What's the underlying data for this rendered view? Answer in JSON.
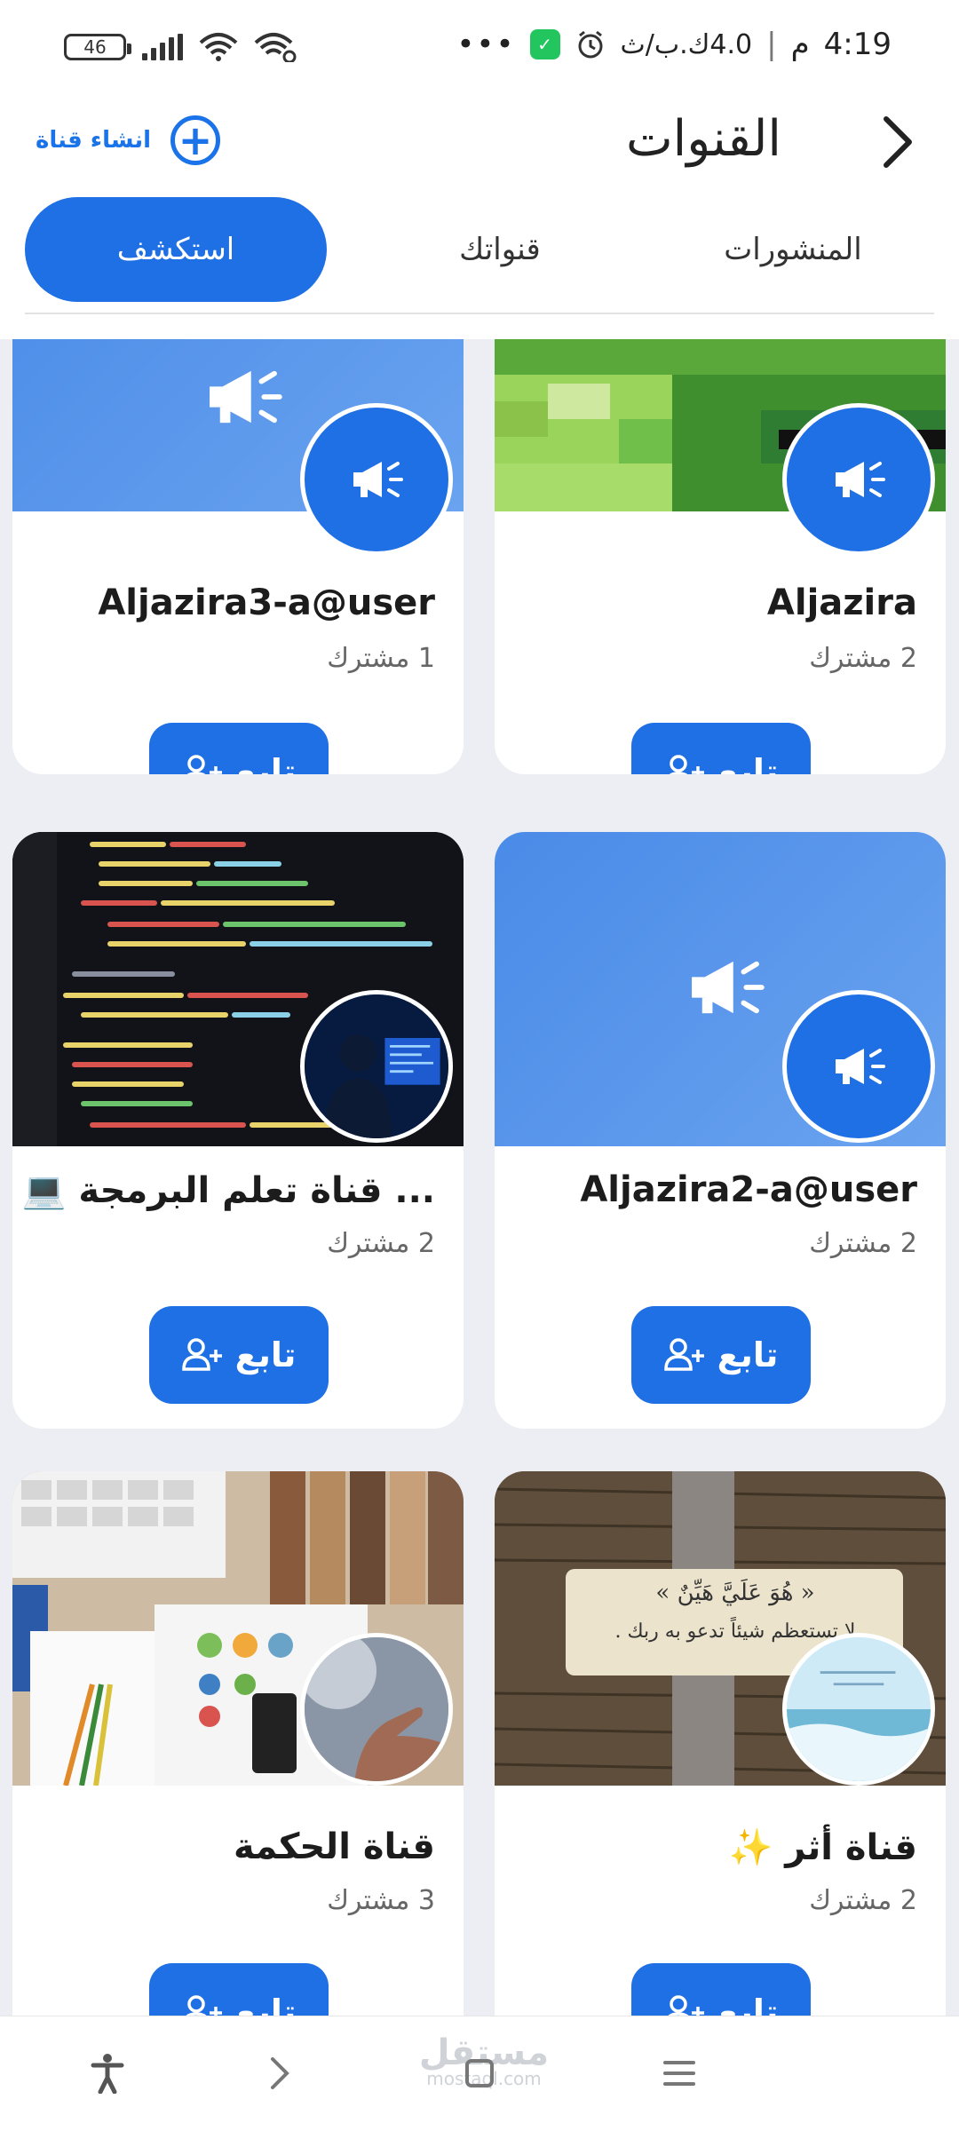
{
  "status_bar": {
    "battery": "46",
    "time": "4:19",
    "ampm": "م",
    "speed": "4.0ك.ب/ث"
  },
  "header": {
    "title": "القنوات",
    "create_label": "انشاء قناة"
  },
  "tabs": [
    {
      "label": "المنشورات",
      "active": false
    },
    {
      "label": "قنواتك",
      "active": false
    },
    {
      "label": "استكشف",
      "active": true
    }
  ],
  "channels": [
    {
      "name": "Aljazira",
      "subscribers": "2 مشترك",
      "follow_label": "تابع",
      "cover": "green-pixel-banner",
      "avatar": "megaphone-icon"
    },
    {
      "name": "Aljazira3-a@user",
      "subscribers": "1 مشترك",
      "follow_label": "تابع",
      "cover": "blue-megaphone-banner",
      "avatar": "megaphone-icon"
    },
    {
      "name": "Aljazira2-a@user",
      "subscribers": "2 مشترك",
      "follow_label": "تابع",
      "cover": "blue-megaphone-banner",
      "avatar": "megaphone-icon"
    },
    {
      "name": "💻 قناة تعلم البرمجة ...",
      "subscribers": "2 مشترك",
      "follow_label": "تابع",
      "cover": "code-editor-photo",
      "avatar": "programmer-photo"
    },
    {
      "name": "قناة أثر ✨",
      "subscribers": "2 مشترك",
      "follow_label": "تابع",
      "cover": "book-page-photo",
      "avatar": "sea-photo"
    },
    {
      "name": "قناة الحكمة",
      "subscribers": "3 مشترك",
      "follow_label": "تابع",
      "cover": "desk-photo",
      "avatar": "hand-photo"
    }
  ],
  "book_quote": {
    "line1": "« هُوَ عَلَيَّ هَيِّنٌ »",
    "line2": "لا تستعظم شيئاً تدعو به ربك ."
  },
  "bottom_nav": {
    "watermark": "مستقل",
    "watermark_sub": "mostaql.com"
  },
  "colors": {
    "accent": "#1f6fe5",
    "content_bg": "#eceef3"
  }
}
